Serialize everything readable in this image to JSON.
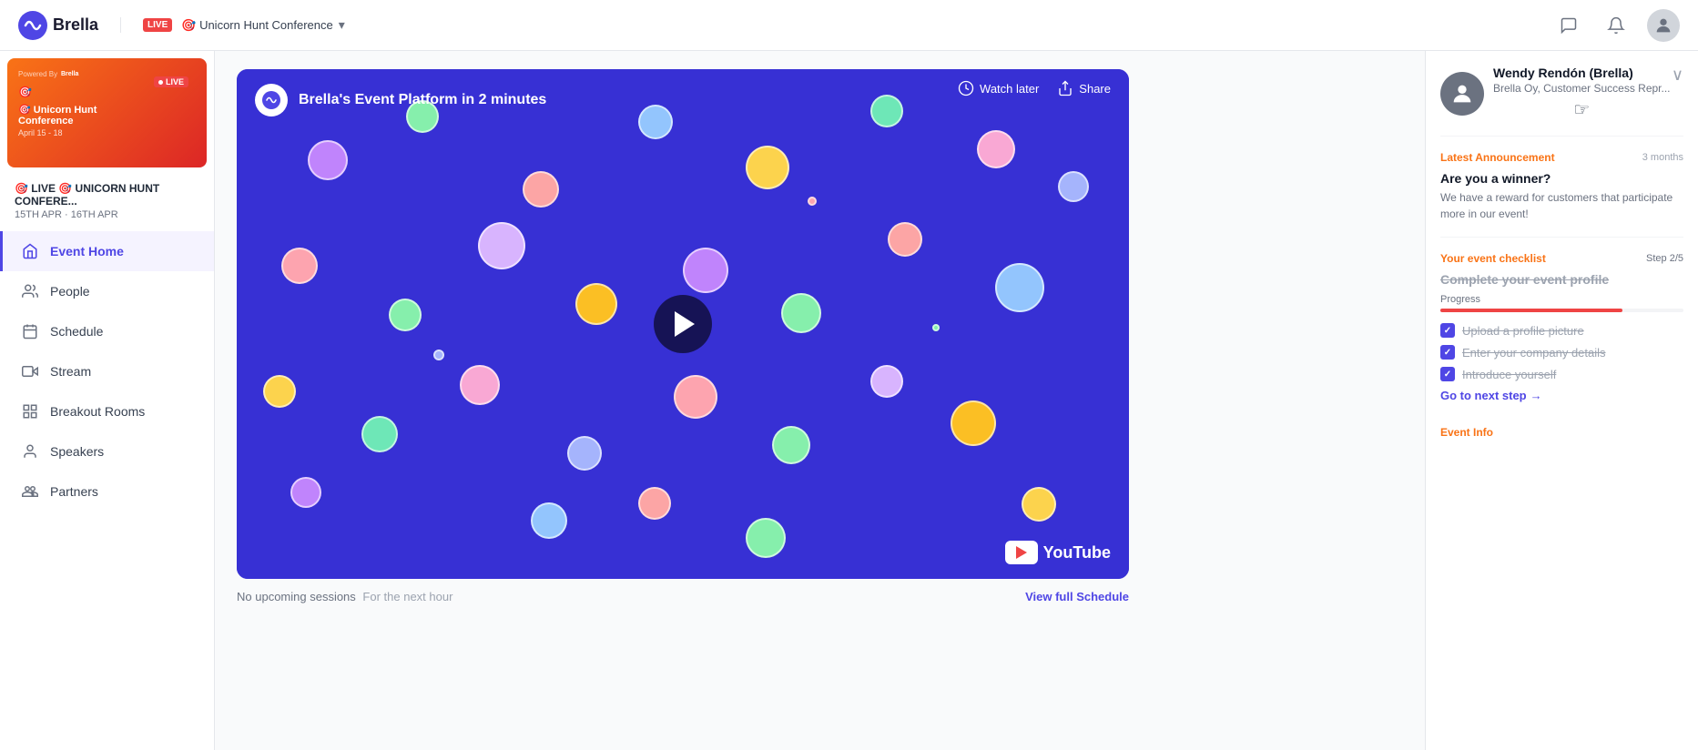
{
  "topNav": {
    "logo": "Brella",
    "liveBadge": "LIVE",
    "eventTitle": "🎯 Unicorn Hunt Conference",
    "chevron": "▾"
  },
  "sidebar": {
    "eventCard": {
      "poweredBy": "Powered By",
      "logoText": "Brella",
      "liveBadge": "LIVE",
      "eventEmoji": "🎯",
      "eventName": "Unicorn Hunt Conference",
      "dates": "April 15 - 18"
    },
    "eventNameUpper": "🎯 LIVE 🎯 UNICORN HUNT CONFERE...",
    "eventDates": "15TH APR · 16TH APR",
    "navItems": [
      {
        "id": "event-home",
        "label": "Event Home",
        "icon": "home",
        "active": true
      },
      {
        "id": "people",
        "label": "People",
        "icon": "people",
        "active": false
      },
      {
        "id": "schedule",
        "label": "Schedule",
        "icon": "calendar",
        "active": false
      },
      {
        "id": "stream",
        "label": "Stream",
        "icon": "stream",
        "active": false
      },
      {
        "id": "breakout-rooms",
        "label": "Breakout Rooms",
        "icon": "breakout",
        "active": false
      },
      {
        "id": "speakers",
        "label": "Speakers",
        "icon": "speakers",
        "active": false
      },
      {
        "id": "partners",
        "label": "Partners",
        "icon": "partners",
        "active": false
      }
    ]
  },
  "video": {
    "logoText": "↩",
    "title": "Brella's Event Platform in 2 minutes",
    "watchLaterLabel": "Watch later",
    "shareLabel": "Share"
  },
  "bottomBar": {
    "noSessions": "No upcoming sessions",
    "forNextHour": "For the next hour",
    "viewFullSchedule": "View full Schedule"
  },
  "rightPanel": {
    "profile": {
      "name": "Wendy Rendón (Brella)",
      "role": "Brella Oy, Customer Success Repr..."
    },
    "announcement": {
      "sectionLabel": "Latest Announcement",
      "time": "3 months",
      "title": "Are you a winner?",
      "body": "We have a reward for customers that participate more in our event!"
    },
    "checklist": {
      "sectionLabel": "Your event checklist",
      "step": "Step 2/5",
      "title": "Complete your event profile",
      "progressLabel": "Progress",
      "progressPercent": 75,
      "items": [
        {
          "label": "Upload a profile picture",
          "checked": true
        },
        {
          "label": "Enter your company details",
          "checked": true
        },
        {
          "label": "Introduce yourself",
          "checked": true
        }
      ],
      "goNextLabel": "Go to next step",
      "arrow": "→"
    },
    "eventInfo": {
      "label": "Event Info"
    }
  }
}
